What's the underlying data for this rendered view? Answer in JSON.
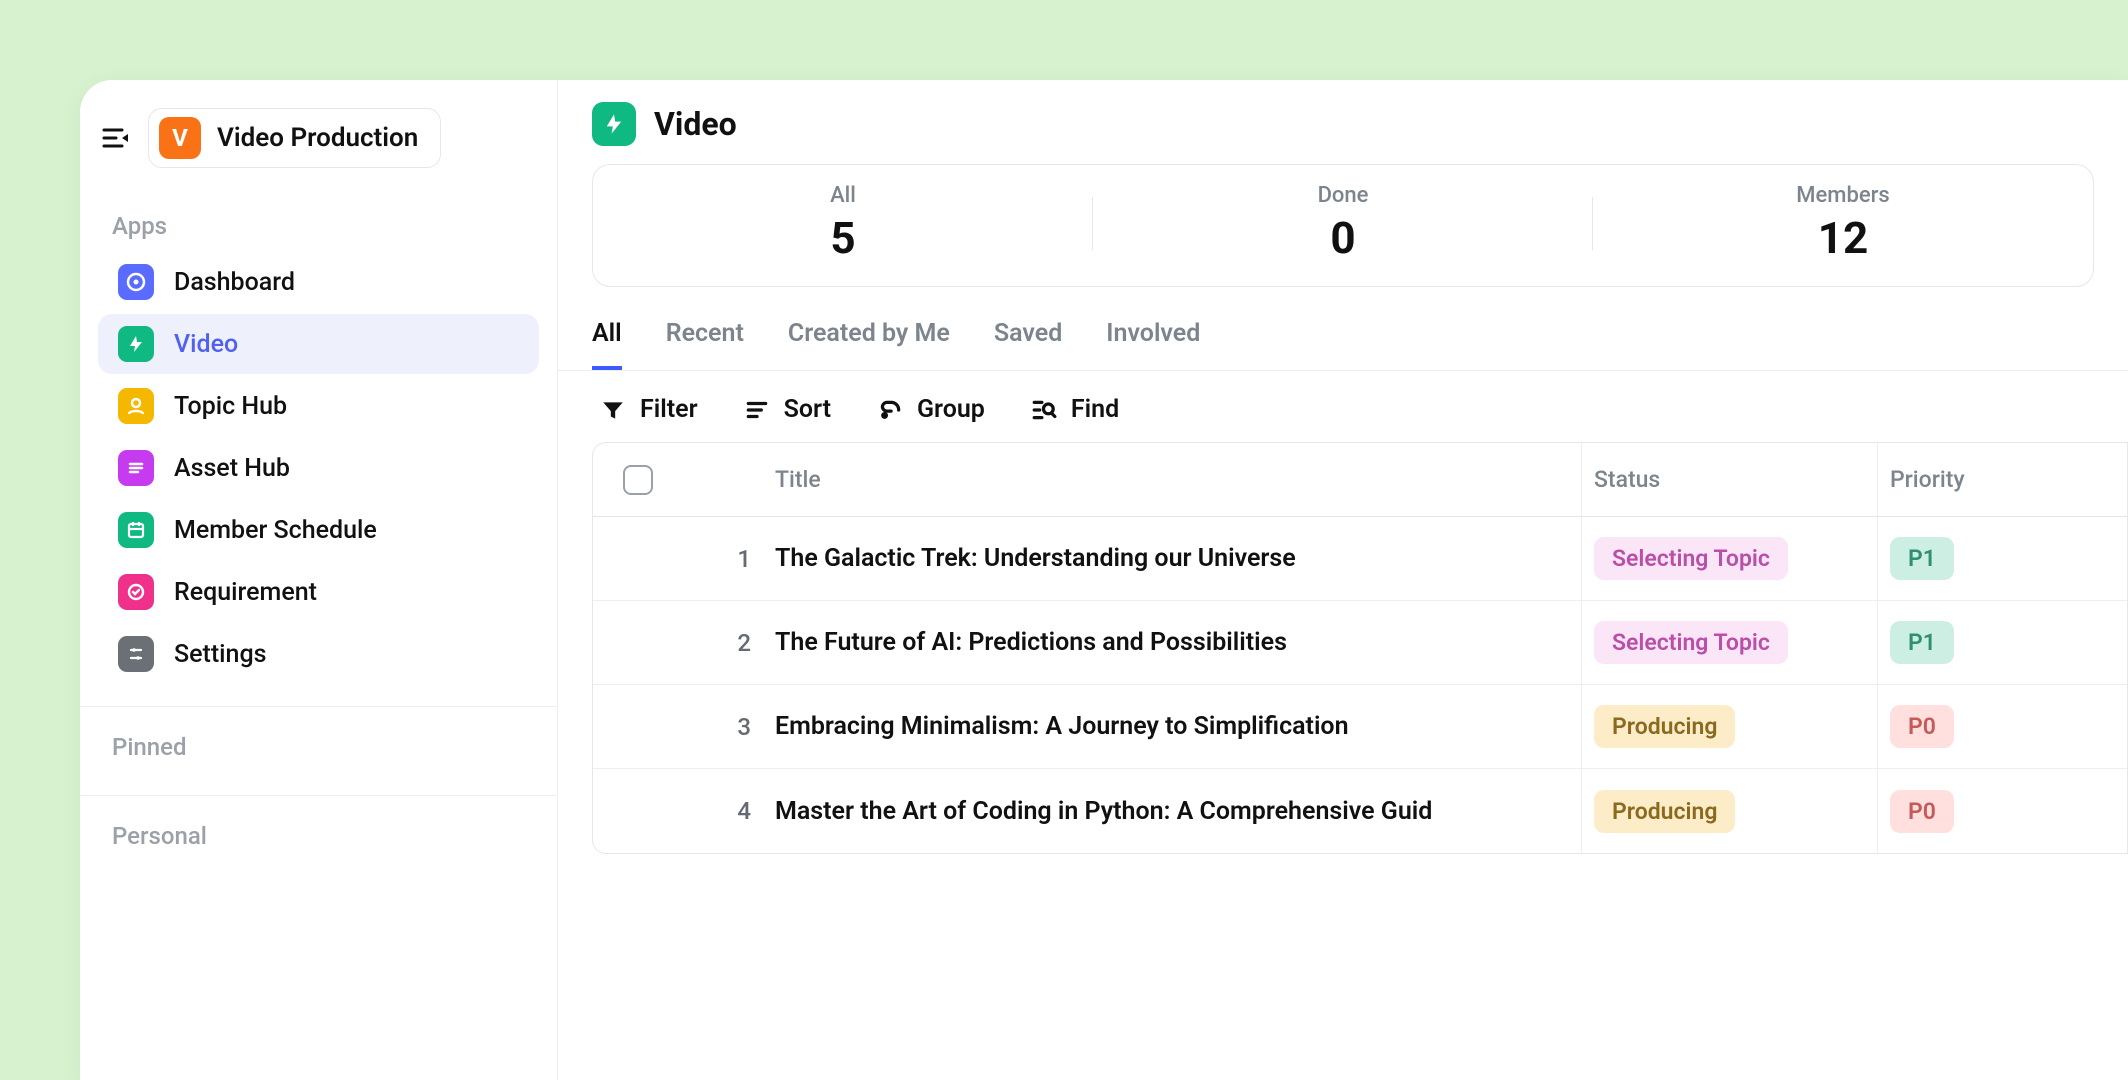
{
  "workspace": {
    "badge": "V",
    "name": "Video Production"
  },
  "sidebar": {
    "sections": {
      "apps_label": "Apps",
      "pinned_label": "Pinned",
      "personal_label": "Personal"
    },
    "nav": [
      {
        "label": "Dashboard"
      },
      {
        "label": "Video"
      },
      {
        "label": "Topic Hub"
      },
      {
        "label": "Asset Hub"
      },
      {
        "label": "Member Schedule"
      },
      {
        "label": "Requirement"
      },
      {
        "label": "Settings"
      }
    ]
  },
  "main": {
    "title": "Video",
    "stats": [
      {
        "label": "All",
        "value": "5"
      },
      {
        "label": "Done",
        "value": "0"
      },
      {
        "label": "Members",
        "value": "12"
      }
    ],
    "tabs": [
      {
        "label": "All"
      },
      {
        "label": "Recent"
      },
      {
        "label": "Created by Me"
      },
      {
        "label": "Saved"
      },
      {
        "label": "Involved"
      }
    ],
    "toolbar": {
      "filter": "Filter",
      "sort": "Sort",
      "group": "Group",
      "find": "Find"
    },
    "table": {
      "headers": {
        "title": "Title",
        "status": "Status",
        "priority": "Priority"
      },
      "rows": [
        {
          "idx": "1",
          "title": "The Galactic Trek: Understanding our Universe",
          "status": "Selecting Topic",
          "status_style": "purple",
          "priority": "P1",
          "priority_style": "teal"
        },
        {
          "idx": "2",
          "title": "The Future of AI: Predictions and Possibilities",
          "status": "Selecting Topic",
          "status_style": "purple",
          "priority": "P1",
          "priority_style": "teal"
        },
        {
          "idx": "3",
          "title": "Embracing Minimalism: A Journey to Simplification",
          "status": "Producing",
          "status_style": "amber",
          "priority": "P0",
          "priority_style": "rose"
        },
        {
          "idx": "4",
          "title": "Master the Art of Coding in Python: A Comprehensive Guid",
          "status": "Producing",
          "status_style": "amber",
          "priority": "P0",
          "priority_style": "rose"
        }
      ]
    }
  }
}
